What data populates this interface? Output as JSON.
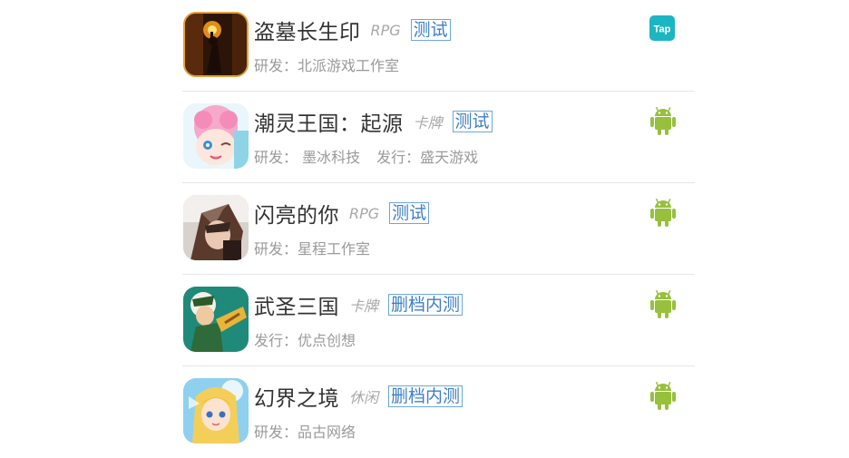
{
  "games": [
    {
      "name": "盗墓长生印",
      "genre": "RPG",
      "tag": "测试",
      "credits": [
        "研发：北派游戏工作室"
      ],
      "platform_icon": "taptap-icon",
      "platform_label": "Tap",
      "platform_color": "#1cb5c2"
    },
    {
      "name": "潮灵王国：起源",
      "genre": "卡牌",
      "tag": "测试",
      "credits": [
        "研发： 墨冰科技",
        "发行：盛天游戏"
      ],
      "platform_icon": "android-icon",
      "platform_color": "#97c03d"
    },
    {
      "name": "闪亮的你",
      "genre": "RPG",
      "tag": "测试",
      "credits": [
        "研发：星程工作室"
      ],
      "platform_icon": "android-icon",
      "platform_color": "#97c03d"
    },
    {
      "name": "武圣三国",
      "genre": "卡牌",
      "tag": "删档内测",
      "credits": [
        "发行：优点创想"
      ],
      "platform_icon": "android-icon",
      "platform_color": "#97c03d"
    },
    {
      "name": "幻界之境",
      "genre": "休闲",
      "tag": "删档内测",
      "credits": [
        "研发：品古网络"
      ],
      "platform_icon": "android-icon",
      "platform_color": "#97c03d"
    }
  ]
}
